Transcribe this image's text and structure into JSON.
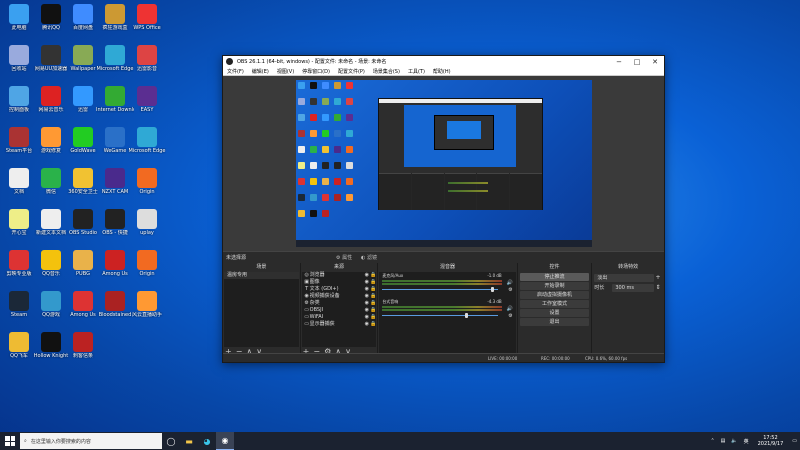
{
  "desktop": {
    "icons": [
      {
        "label": "此电脑",
        "color": "#3aa0f0"
      },
      {
        "label": "腾讯QQ",
        "color": "#111"
      },
      {
        "label": "百度网盘",
        "color": "#3f8cff"
      },
      {
        "label": "疯狂游戏盒",
        "color": "#c93"
      },
      {
        "label": "WPS Office",
        "color": "#e33"
      },
      {
        "label": "回收站",
        "color": "#9ad"
      },
      {
        "label": "网易UU加速器",
        "color": "#333"
      },
      {
        "label": "Wallpaper",
        "color": "#8a5"
      },
      {
        "label": "Microsoft Edge",
        "color": "#2fa9d5"
      },
      {
        "label": "迅雷影音",
        "color": "#d44"
      },
      {
        "label": "控制面板",
        "color": "#4fa5e5"
      },
      {
        "label": "网易云音乐",
        "color": "#d22"
      },
      {
        "label": "迅雷",
        "color": "#39f"
      },
      {
        "label": "Internet Downloader",
        "color": "#3a3"
      },
      {
        "label": "EASY",
        "color": "#5b2e91"
      },
      {
        "label": "Steam平台",
        "color": "#a33"
      },
      {
        "label": "游戏修复",
        "color": "#f93"
      },
      {
        "label": "GoldWave",
        "color": "#2c2"
      },
      {
        "label": "WeGame",
        "color": "#2a70c8"
      },
      {
        "label": "Microsoft Edge",
        "color": "#2fa9d5"
      },
      {
        "label": "文档",
        "color": "#eee"
      },
      {
        "label": "微信",
        "color": "#2ab24a"
      },
      {
        "label": "360安全卫士",
        "color": "#f1c232"
      },
      {
        "label": "NZXT CAM",
        "color": "#4a2a8c"
      },
      {
        "label": "Origin",
        "color": "#f26a21"
      },
      {
        "label": "开心宝",
        "color": "#ee8"
      },
      {
        "label": "新建文本文档",
        "color": "#eee"
      },
      {
        "label": "OBS Studio",
        "color": "#222"
      },
      {
        "label": "OBS - 快捷",
        "color": "#222"
      },
      {
        "label": "uplay",
        "color": "#ddd"
      },
      {
        "label": "剪映专业版",
        "color": "#d33"
      },
      {
        "label": "QQ音乐",
        "color": "#f4c20d"
      },
      {
        "label": "PUBG",
        "color": "#e9b24a"
      },
      {
        "label": "Among Us",
        "color": "#c22"
      },
      {
        "label": "Origin",
        "color": "#f26a21"
      },
      {
        "label": "Steam",
        "color": "#1b2838"
      },
      {
        "label": "QQ游戏",
        "color": "#39c"
      },
      {
        "label": "Among Us",
        "color": "#d33"
      },
      {
        "label": "Bloodstained",
        "color": "#a22"
      },
      {
        "label": "风云直播助手",
        "color": "#f93"
      },
      {
        "label": "QQ飞车",
        "color": "#eb3"
      },
      {
        "label": "Hollow Knight",
        "color": "#111"
      },
      {
        "label": "刺客信条",
        "color": "#b22"
      }
    ]
  },
  "obs": {
    "title": "OBS 26.1.1 (64-bit, windows) - 配置文件: 未命名 - 场景: 未命名",
    "menu": [
      "文件(F)",
      "编辑(E)",
      "视图(V)",
      "停靠窗口(D)",
      "配置文件(P)",
      "场景集合(S)",
      "工具(T)",
      "帮助(H)"
    ],
    "no_source": "未选择源",
    "props_label": "属性",
    "filters_label": "滤镜",
    "docks": {
      "scenes_title": "场景",
      "sources_title": "来源",
      "mixer_title": "混音器",
      "controls_title": "控件",
      "transitions_title": "转场特效"
    },
    "scene_items": [
      "温房专用"
    ],
    "sources": [
      {
        "icon": "◎",
        "name": "浏览器"
      },
      {
        "icon": "▣",
        "name": "图像"
      },
      {
        "icon": "T",
        "name": "文本 (GDI+)"
      },
      {
        "icon": "◉",
        "name": "视频捕获设备"
      },
      {
        "icon": "⚙",
        "name": "杂类"
      },
      {
        "icon": "▭",
        "name": "OBSJI"
      },
      {
        "icon": "▭",
        "name": "WiFAI"
      },
      {
        "icon": "▭",
        "name": "显示器捕获"
      }
    ],
    "mixer": [
      {
        "name": "麦克风/Aux",
        "db": "-1.0 dB"
      },
      {
        "name": "台式音响",
        "db": "-4.3 dB"
      }
    ],
    "controls": [
      "停止推流",
      "开始录制",
      "启动虚拟摄像机",
      "工作室模式",
      "设置",
      "退出"
    ],
    "transitions": {
      "type": "淡出",
      "duration_label": "时长",
      "duration": "300 ms"
    },
    "status": {
      "dropped": "丢帧 0 (0.0%)",
      "live": "LIVE: 00:00:00",
      "rec": "REC: 00:00:00",
      "cpu": "CPU: 0.6%, 60.00 fps"
    },
    "foot_add": "+",
    "foot_remove": "−",
    "foot_up": "∧",
    "foot_down": "∨",
    "foot_gear": "⚙"
  },
  "taskbar": {
    "search_placeholder": "在这里输入你要搜索的内容",
    "time": "17:52",
    "date": "2021/9/17",
    "lang": "英"
  },
  "colors": {
    "accent": "#0a61d6"
  }
}
